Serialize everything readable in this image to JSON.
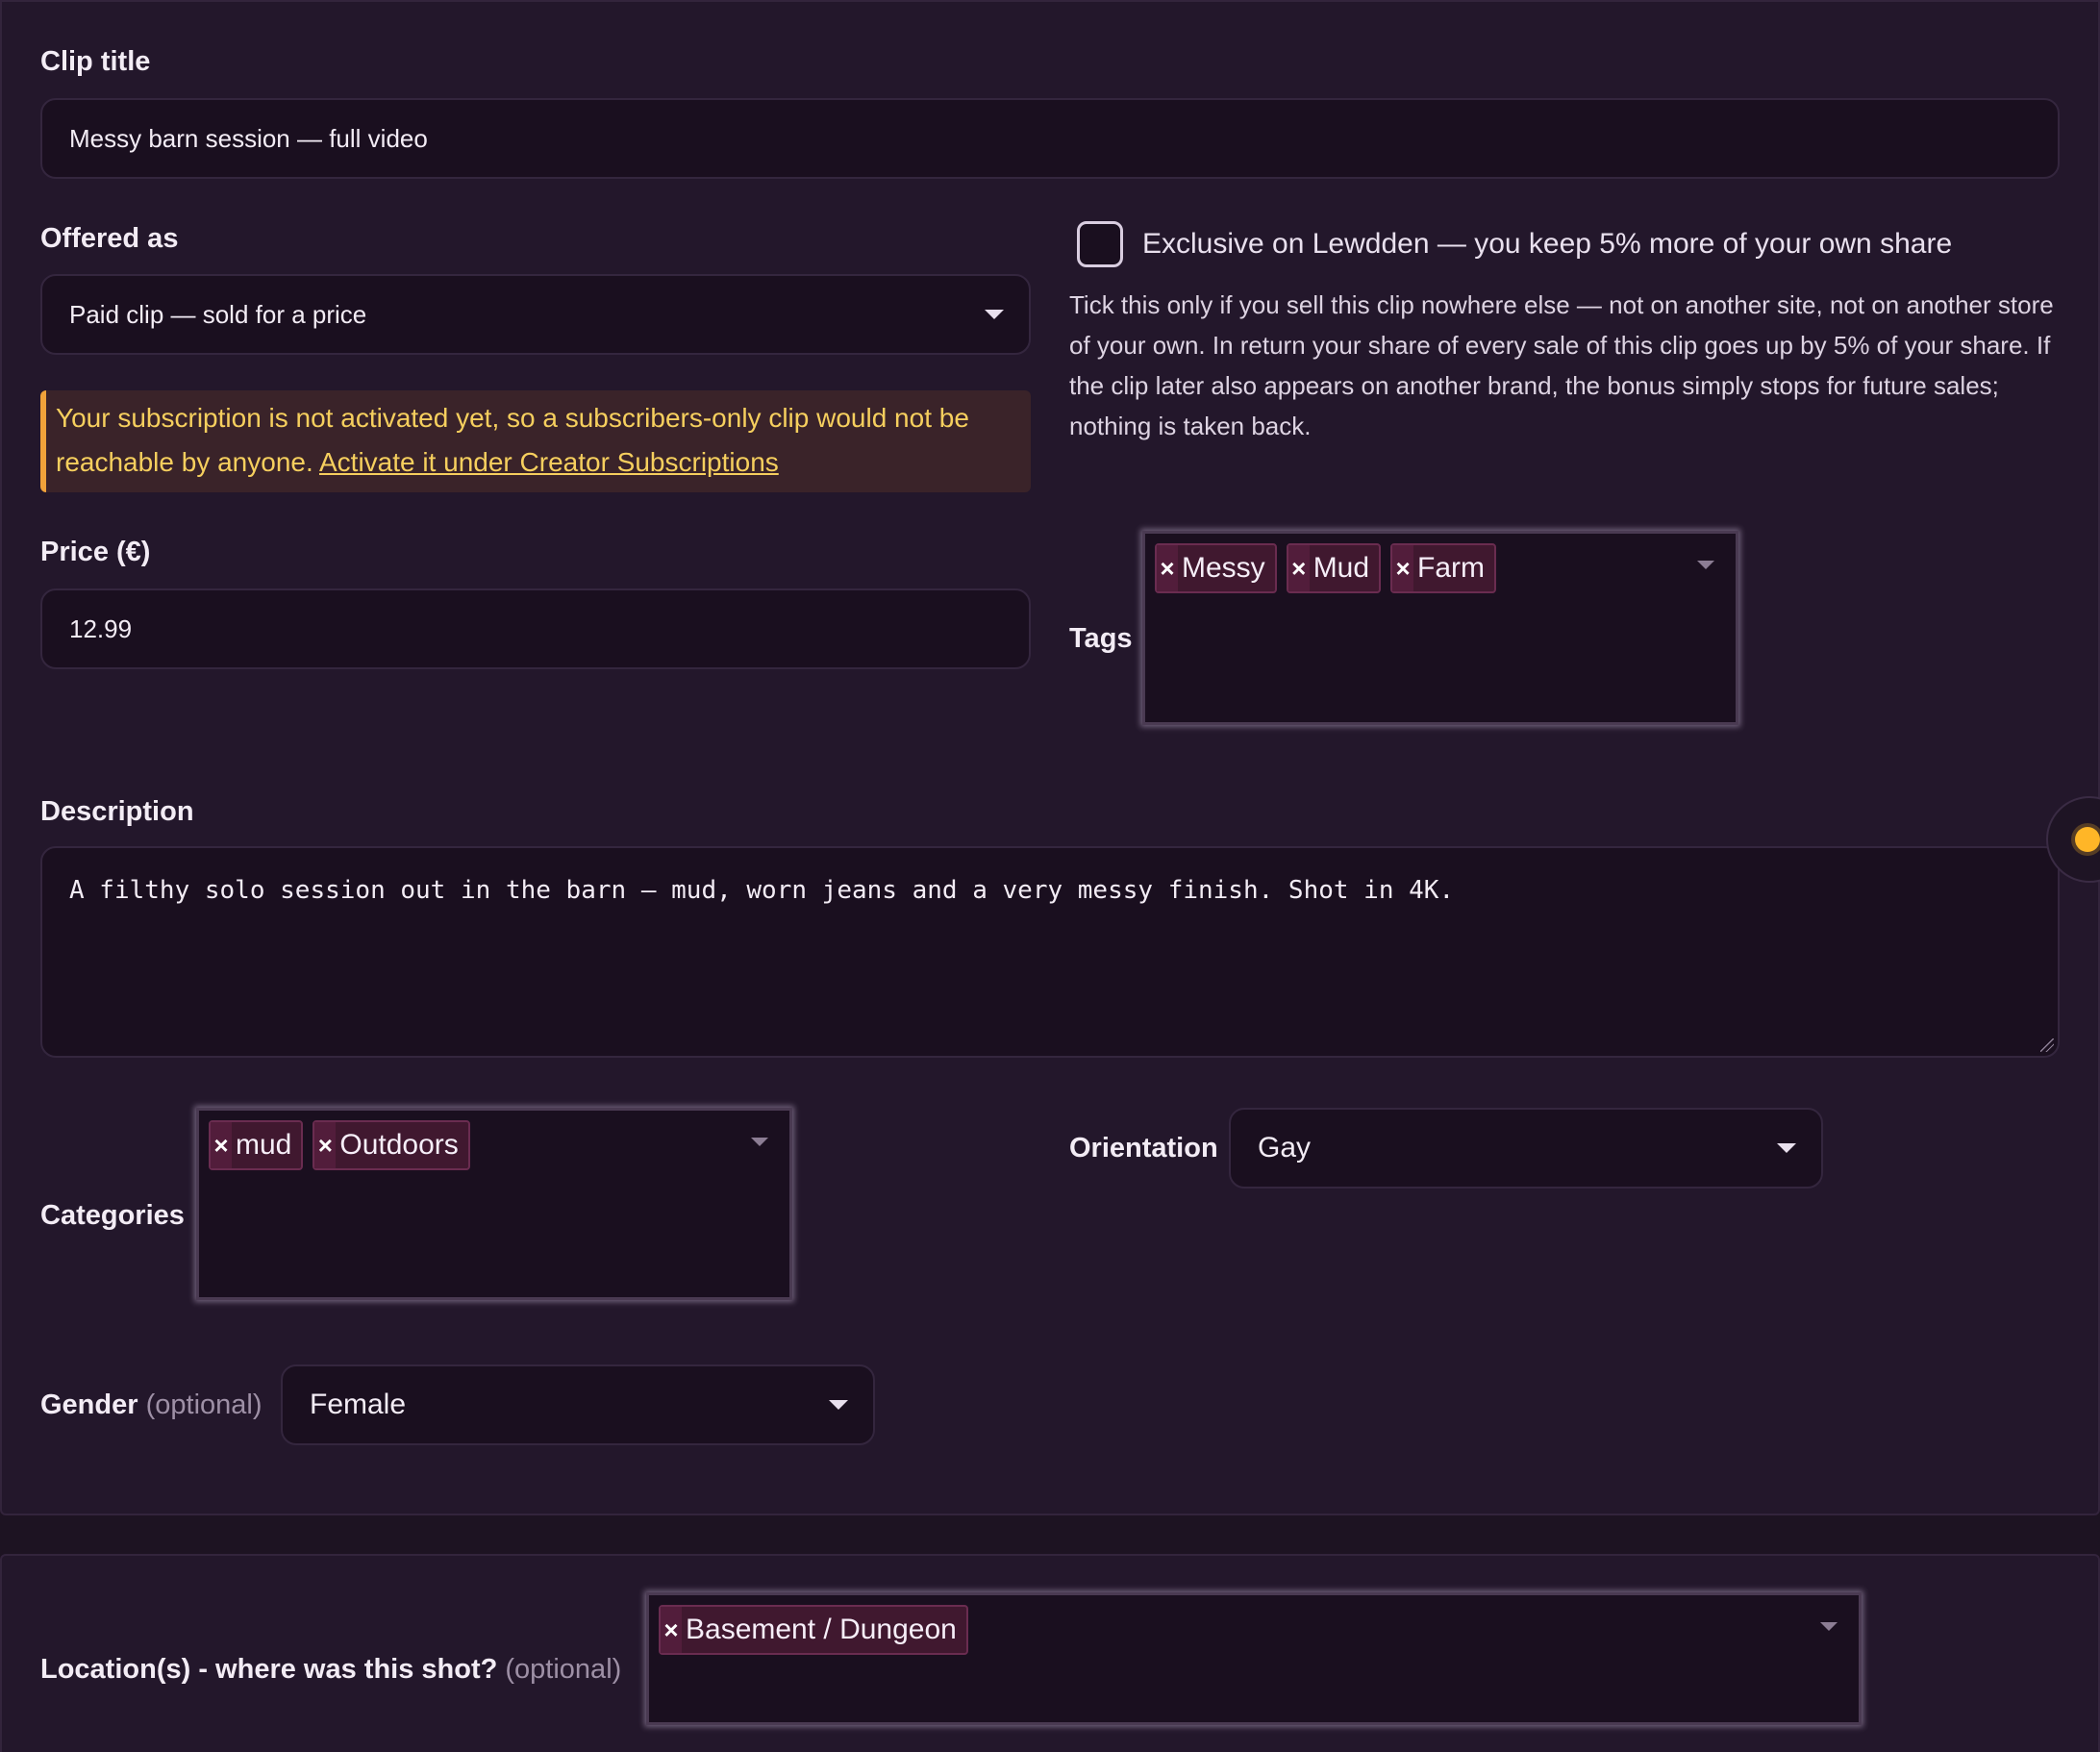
{
  "clip_title": {
    "label": "Clip title",
    "value": "Messy barn session — full video"
  },
  "offered_as": {
    "label": "Offered as",
    "value": "Paid clip — sold for a price"
  },
  "warning": {
    "text": "Your subscription is not activated yet, so a subscribers-only clip would not be reachable by anyone.",
    "link": "Activate it under Creator Subscriptions"
  },
  "exclusive": {
    "label": "Exclusive on Lewdden — you keep 5% more of your own share",
    "checked": false,
    "help": "Tick this only if you sell this clip nowhere else — not on another site, not on another store of your own. In return your share of every sale of this clip goes up by 5% of your share. If the clip later also appears on another brand, the bonus simply stops for future sales; nothing is taken back."
  },
  "price": {
    "label": "Price (€)",
    "value": "12.99"
  },
  "tags": {
    "label": "Tags",
    "items": [
      "Messy",
      "Mud",
      "Farm"
    ]
  },
  "description": {
    "label": "Description",
    "value": "A filthy solo session out in the barn — mud, worn jeans and a very messy finish. Shot in 4K."
  },
  "categories": {
    "label": "Categories",
    "items": [
      "mud",
      "Outdoors"
    ]
  },
  "orientation": {
    "label": "Orientation",
    "value": "Gay"
  },
  "gender": {
    "label": "Gender",
    "optional": "(optional)",
    "value": "Female"
  },
  "locations": {
    "label": "Location(s) - where was this shot?",
    "optional": "(optional)",
    "items": [
      "Basement / Dungeon"
    ]
  },
  "icons": {
    "remove_chip": "close-icon",
    "dropdown": "chevron-down-icon",
    "theme_toggle": "sun-icon"
  },
  "colors": {
    "background": "#1d1322",
    "card": "#23172b",
    "field": "#1a0f1f",
    "chip": "#40182f",
    "warning_text": "#f6cf5e",
    "warning_border": "#f0a23a",
    "sun": "#ffb627"
  }
}
